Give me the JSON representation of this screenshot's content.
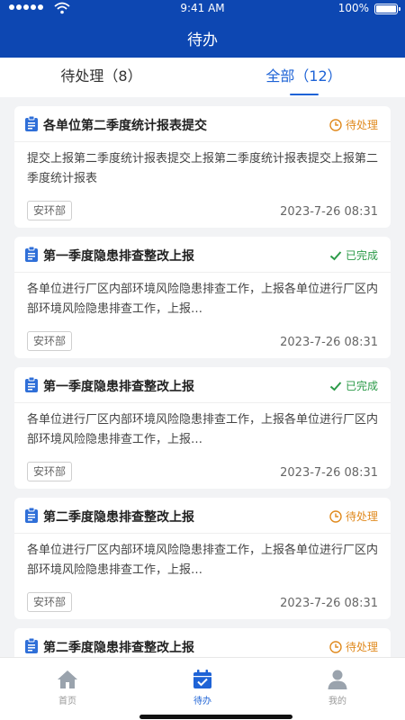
{
  "status_bar": {
    "time": "9:41 AM",
    "battery": "100%"
  },
  "header": {
    "title": "待办"
  },
  "tabs": [
    {
      "label": "待处理（8）",
      "active": false
    },
    {
      "label": "全部（12）",
      "active": true
    }
  ],
  "colors": {
    "brand": "#0d47b2",
    "accent": "#1e63d6",
    "pending": "#e08a1e",
    "done": "#2b9a48"
  },
  "tasks": [
    {
      "title": "各单位第二季度统计报表提交",
      "status": "待处理",
      "status_type": "pending",
      "content": "提交上报第二季度统计报表提交上报第二季度统计报表提交上报第二季度统计报表",
      "dept": "安环部",
      "date": "2023-7-26  08:31"
    },
    {
      "title": "第一季度隐患排查整改上报",
      "status": "已完成",
      "status_type": "done",
      "content": "各单位进行厂区内部环境风险隐患排查工作，上报各单位进行厂区内部环境风险隐患排查工作，上报…",
      "dept": "安环部",
      "date": "2023-7-26  08:31"
    },
    {
      "title": "第一季度隐患排查整改上报",
      "status": "已完成",
      "status_type": "done",
      "content": "各单位进行厂区内部环境风险隐患排查工作，上报各单位进行厂区内部环境风险隐患排查工作，上报…",
      "dept": "安环部",
      "date": "2023-7-26  08:31"
    },
    {
      "title": "第二季度隐患排查整改上报",
      "status": "待处理",
      "status_type": "pending",
      "content": "各单位进行厂区内部环境风险隐患排查工作，上报各单位进行厂区内部环境风险隐患排查工作，上报…",
      "dept": "安环部",
      "date": "2023-7-26  08:31"
    },
    {
      "title": "第二季度隐患排查整改上报",
      "status": "待处理",
      "status_type": "pending",
      "content": "",
      "dept": "",
      "date": ""
    }
  ],
  "nav": [
    {
      "label": "首页",
      "icon": "home-icon",
      "active": false
    },
    {
      "label": "待办",
      "icon": "calendar-check-icon",
      "active": true
    },
    {
      "label": "我的",
      "icon": "person-icon",
      "active": false
    }
  ]
}
